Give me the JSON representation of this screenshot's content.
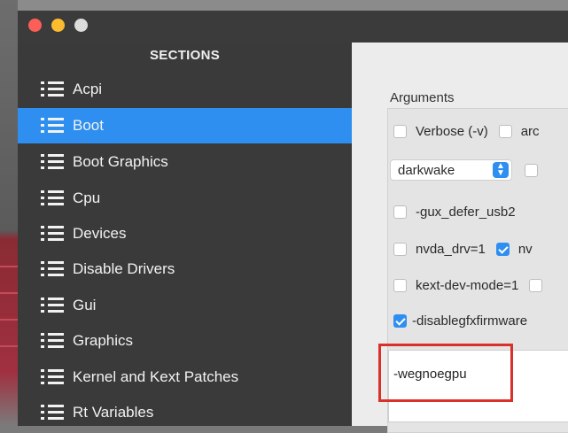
{
  "sidebar": {
    "header": "SECTIONS",
    "items": [
      {
        "label": "Acpi",
        "selected": false
      },
      {
        "label": "Boot",
        "selected": true
      },
      {
        "label": "Boot Graphics",
        "selected": false
      },
      {
        "label": "Cpu",
        "selected": false
      },
      {
        "label": "Devices",
        "selected": false
      },
      {
        "label": "Disable Drivers",
        "selected": false
      },
      {
        "label": "Gui",
        "selected": false
      },
      {
        "label": "Graphics",
        "selected": false
      },
      {
        "label": "Kernel and Kext Patches",
        "selected": false
      },
      {
        "label": "Rt Variables",
        "selected": false
      }
    ]
  },
  "arguments": {
    "label": "Arguments",
    "verbose": {
      "label": "Verbose (-v)",
      "checked": false
    },
    "arc_partial": {
      "label": "arc",
      "checked": false
    },
    "select": {
      "value": "darkwake"
    },
    "gux": {
      "label": "-gux_defer_usb2",
      "checked": false
    },
    "nvda": {
      "label": "nvda_drv=1",
      "checked": false
    },
    "nv_partial": {
      "label": "nv",
      "checked": true
    },
    "kext": {
      "label": "kext-dev-mode=1",
      "checked": false
    },
    "disablegfx": {
      "label": "-disablegfxfirmware",
      "checked": true
    },
    "textarea_value": "-wegnoegpu"
  },
  "colors": {
    "accent": "#2e8ff0",
    "sidebar_bg": "#3a3a3a",
    "highlight": "#d9302a"
  }
}
